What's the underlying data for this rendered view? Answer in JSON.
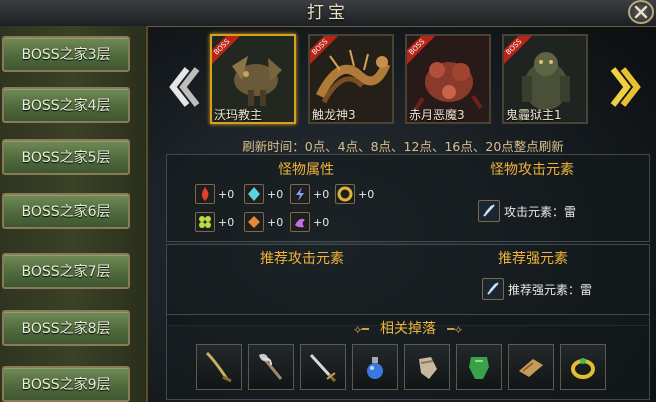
{
  "window": {
    "title": "打宝",
    "close_icon": "close-icon"
  },
  "sidebar": {
    "items": [
      {
        "label": "BOSS之家3层"
      },
      {
        "label": "BOSS之家4层"
      },
      {
        "label": "BOSS之家5层"
      },
      {
        "label": "BOSS之家6层"
      },
      {
        "label": "BOSS之家7层"
      },
      {
        "label": "BOSS之家8层"
      },
      {
        "label": "BOSS之家9层"
      }
    ]
  },
  "bosses": {
    "tag": "BOSS",
    "items": [
      {
        "name": "沃玛教主",
        "selected": true
      },
      {
        "name": "触龙神3",
        "selected": false
      },
      {
        "name": "赤月恶魔3",
        "selected": false
      },
      {
        "name": "鬼霾狱主1",
        "selected": false
      }
    ],
    "prev_icon": "chevron-left-icon",
    "next_icon": "chevron-right-icon"
  },
  "refresh_text": "刷新时间：0点、4点、8点、12点、16点、20点整点刷新",
  "monster_attributes": {
    "title": "怪物属性",
    "items": [
      {
        "icon": "fire-icon",
        "value": "+0"
      },
      {
        "icon": "ice-icon",
        "value": "+0"
      },
      {
        "icon": "lightning-icon",
        "value": "+0"
      },
      {
        "icon": "earth-icon",
        "value": "+0"
      },
      {
        "icon": "wind-icon",
        "value": "+0"
      },
      {
        "icon": "light-icon",
        "value": "+0"
      },
      {
        "icon": "dark-icon",
        "value": "+0"
      }
    ]
  },
  "monster_attack_element": {
    "title": "怪物攻击元素",
    "label": "攻击元素：雷"
  },
  "recommended_attack_element": {
    "title": "推荐攻击元素"
  },
  "recommended_strong_element": {
    "title": "推荐强元素",
    "label": "推荐强元素：雷"
  },
  "drops": {
    "title": "相关掉落",
    "items": [
      "sword-icon",
      "axe-icon",
      "blade-icon",
      "potion-icon",
      "gauntlet-icon",
      "armor-icon",
      "scroll-icon",
      "ring-icon"
    ]
  },
  "colors": {
    "accent": "#f0b43c",
    "refresh": "#d9c18a",
    "selected_border": "#d8a020",
    "boss_tag": "#b82418"
  }
}
